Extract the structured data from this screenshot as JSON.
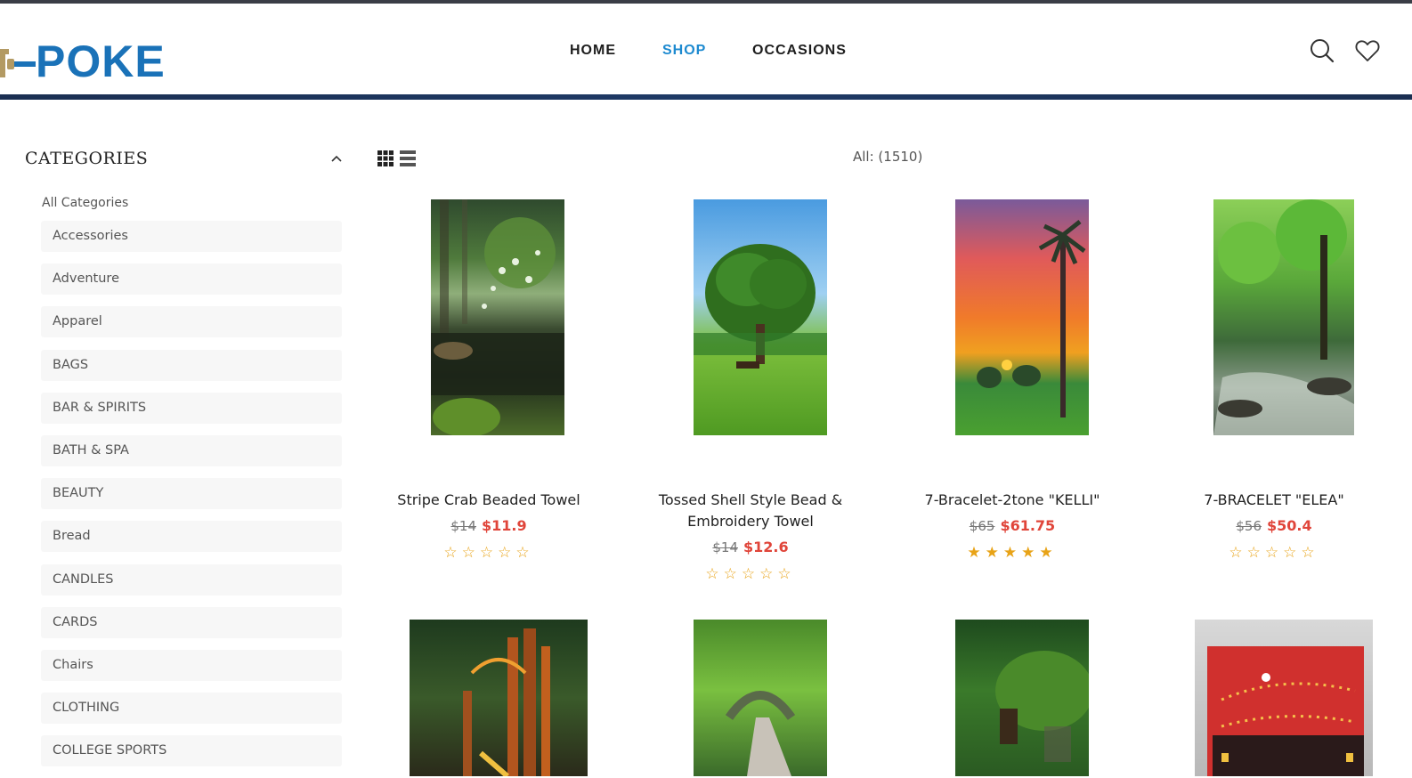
{
  "header": {
    "logo_text": "POKE",
    "nav": [
      {
        "label": "HOME"
      },
      {
        "label": "SHOP"
      },
      {
        "label": "OCCASIONS"
      }
    ],
    "icons": [
      "search-icon",
      "heart-icon"
    ],
    "colors": {
      "accent": "#1d8ad0",
      "logo_blue": "#1a72b8",
      "logo_gold": "#b39a63",
      "header_bar": "#1e3a66"
    }
  },
  "sidebar": {
    "title": "CATEGORIES",
    "all_label": "All Categories",
    "items": [
      {
        "label": "Accessories"
      },
      {
        "label": "Adventure"
      },
      {
        "label": "Apparel"
      },
      {
        "label": "BAGS"
      },
      {
        "label": "BAR & SPIRITS"
      },
      {
        "label": "BATH & SPA"
      },
      {
        "label": "BEAUTY"
      },
      {
        "label": "Bread"
      },
      {
        "label": "CANDLES"
      },
      {
        "label": "CARDS"
      },
      {
        "label": "Chairs"
      },
      {
        "label": "CLOTHING"
      },
      {
        "label": "COLLEGE SPORTS"
      }
    ]
  },
  "toolbar": {
    "count": "All: (1510)"
  },
  "products": [
    {
      "name": "Stripe Crab Beaded Towel",
      "old_price": "$14",
      "new_price": "$11.9",
      "rating": 0,
      "stars": "☆☆☆☆☆",
      "image": "forest-stream"
    },
    {
      "name": "Tossed Shell Style Bead & Embroidery Towel",
      "old_price": "$14",
      "new_price": "$12.6",
      "rating": 0,
      "stars": "☆☆☆☆☆",
      "image": "tree-field"
    },
    {
      "name": "7-Bracelet-2tone \"KELLI\"",
      "old_price": "$65",
      "new_price": "$61.75",
      "rating": 5,
      "stars": "★★★★★",
      "image": "palm-sunset"
    },
    {
      "name": "7-BRACELET \"ELEA\"",
      "old_price": "$56",
      "new_price": "$50.4",
      "rating": 0,
      "stars": "☆☆☆☆☆",
      "image": "green-river"
    },
    {
      "name": "",
      "image": "wood-portal"
    },
    {
      "name": "",
      "image": "arch-path"
    },
    {
      "name": "",
      "image": "mossy-hill"
    },
    {
      "name": "",
      "image": "red-card-lights"
    }
  ]
}
